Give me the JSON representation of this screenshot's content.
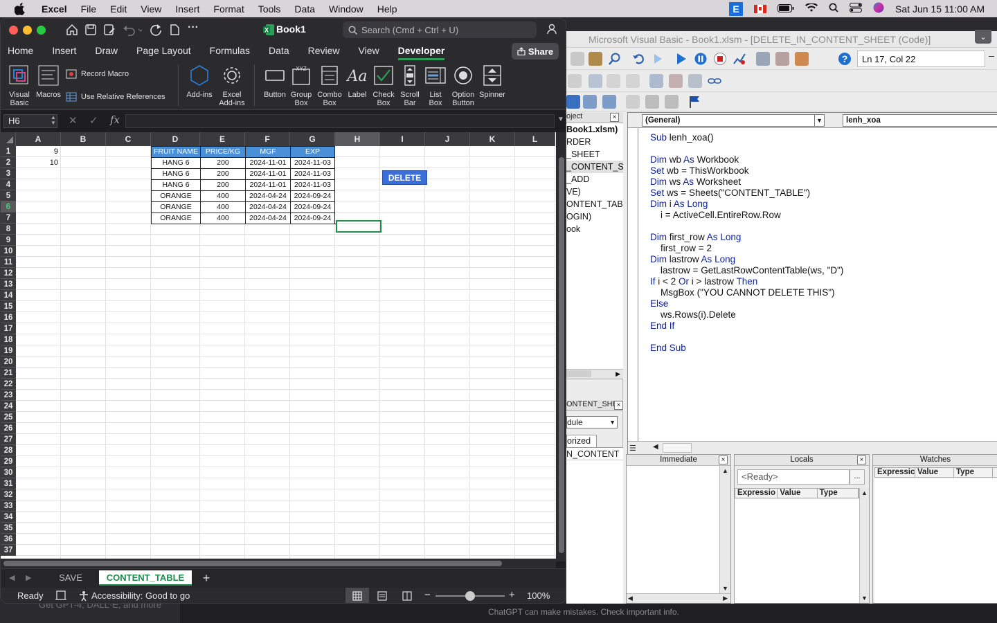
{
  "menubar": {
    "app": "Excel",
    "items": [
      "File",
      "Edit",
      "View",
      "Insert",
      "Format",
      "Tools",
      "Data",
      "Window",
      "Help"
    ],
    "input_badge": "E",
    "datetime": "Sat Jun 15  11:00 AM"
  },
  "background": {
    "left_text": "Get GPT-4, DALL·E, and more",
    "mid_text": "ChatGPT can make mistakes. Check important info."
  },
  "vbe": {
    "title": "Microsoft Visual Basic - Book1.xlsm - [DELETE_IN_CONTENT_SHEET (Code)]",
    "position": "Ln 17, Col 22",
    "project_header": "oject",
    "project_items": [
      "Book1.xlsm)",
      "RDER",
      "_SHEET",
      "_CONTENT_S",
      "_ADD",
      "VE)",
      "ONTENT_TAB",
      "OGIN)",
      "ook"
    ],
    "props_header": "ONTENT_SHE",
    "props_dropdown": "dule",
    "props_tab": "orized",
    "props_value": "N_CONTENT",
    "combo_general": "(General)",
    "combo_proc": "lenh_xoa",
    "code": [
      {
        "t": "Sub lenh_xoa()",
        "k": [
          "Sub"
        ]
      },
      {
        "t": "",
        "k": []
      },
      {
        "t": "Dim wb As Workbook",
        "k": [
          "Dim",
          "As"
        ]
      },
      {
        "t": "Set wb = ThisWorkbook",
        "k": [
          "Set"
        ]
      },
      {
        "t": "Dim ws As Worksheet",
        "k": [
          "Dim",
          "As"
        ]
      },
      {
        "t": "Set ws = Sheets(\"CONTENT_TABLE\")",
        "k": [
          "Set"
        ]
      },
      {
        "t": "Dim i As Long",
        "k": [
          "Dim",
          "As",
          "Long"
        ]
      },
      {
        "t": "    i = ActiveCell.EntireRow.Row",
        "k": []
      },
      {
        "t": "",
        "k": []
      },
      {
        "t": "Dim first_row As Long",
        "k": [
          "Dim",
          "As",
          "Long"
        ]
      },
      {
        "t": "    first_row = 2",
        "k": []
      },
      {
        "t": "Dim lastrow As Long",
        "k": [
          "Dim",
          "As",
          "Long"
        ]
      },
      {
        "t": "    lastrow = GetLastRowContentTable(ws, \"D\")",
        "k": []
      },
      {
        "t": "If i < 2 Or i > lastrow Then",
        "k": [
          "If",
          "Or",
          "Then"
        ]
      },
      {
        "t": "    MsgBox (\"YOU CANNOT DELETE THIS\")",
        "k": []
      },
      {
        "t": "Else",
        "k": [
          "Else"
        ]
      },
      {
        "t": "    ws.Rows(i).Delete",
        "k": []
      },
      {
        "t": "End If",
        "k": [
          "End",
          "If"
        ]
      },
      {
        "t": "",
        "k": []
      },
      {
        "t": "End Sub",
        "k": [
          "End",
          "Sub"
        ]
      }
    ],
    "immediate_title": "Immediate",
    "locals_title": "Locals",
    "locals_status": "<Ready>",
    "locals_ellipsis": "...",
    "locals_cols": [
      "Expressio",
      "Value",
      "Type"
    ],
    "watches_title": "Watches",
    "watches_cols": [
      "Expressic",
      "Value",
      "Type"
    ]
  },
  "excel": {
    "book_title": "Book1",
    "search_placeholder": "Search (Cmd + Ctrl + U)",
    "tabs": [
      "Home",
      "Insert",
      "Draw",
      "Page Layout",
      "Formulas",
      "Data",
      "Review",
      "View",
      "Developer"
    ],
    "active_tab": "Developer",
    "share": "Share",
    "ribbon": {
      "visual_basic": [
        "Visual",
        "Basic"
      ],
      "macros": "Macros",
      "record_macro": "Record Macro",
      "relative_refs": "Use Relative References",
      "addins": "Add-ins",
      "excel_addins": [
        "Excel",
        "Add-ins"
      ],
      "button": "Button",
      "group_box": [
        "Group",
        "Box"
      ],
      "combo_box": [
        "Combo",
        "Box"
      ],
      "label": "Label",
      "check_box": [
        "Check",
        "Box"
      ],
      "scroll_bar": [
        "Scroll",
        "Bar"
      ],
      "list_box": [
        "List",
        "Box"
      ],
      "option_button": [
        "Option",
        "Button"
      ],
      "spinner": "Spinner"
    },
    "name_box": "H6",
    "fx": "fx",
    "columns": [
      "A",
      "B",
      "C",
      "D",
      "E",
      "F",
      "G",
      "H",
      "I",
      "J",
      "K",
      "L"
    ],
    "selected_col": "H",
    "selected_row": 6,
    "a_values": [
      {
        "row": 1,
        "v": "9"
      },
      {
        "row": 2,
        "v": "10"
      }
    ],
    "table_header": [
      "FRUIT NAME",
      "PRICE/KG",
      "MGF",
      "EXP"
    ],
    "table_rows": [
      [
        "HANG 6",
        "200",
        "2024-11-01",
        "2024-11-03"
      ],
      [
        "HANG 6",
        "200",
        "2024-11-01",
        "2024-11-03"
      ],
      [
        "HANG 6",
        "200",
        "2024-11-01",
        "2024-11-03"
      ],
      [
        "ORANGE",
        "400",
        "2024-04-24",
        "2024-09-24"
      ],
      [
        "ORANGE",
        "400",
        "2024-04-24",
        "2024-09-24"
      ],
      [
        "ORANGE",
        "400",
        "2024-04-24",
        "2024-09-24"
      ]
    ],
    "delete_button": "DELETE",
    "sheet_tabs": [
      "SAVE",
      "CONTENT_TABLE"
    ],
    "active_sheet": "CONTENT_TABLE",
    "add_sheet": "+",
    "status_ready": "Ready",
    "accessibility": "Accessibility: Good to go",
    "zoom": "100%",
    "zoom_minus": "−",
    "zoom_plus": "+",
    "colors": {
      "accent": "#2aa05a",
      "table_header": "#4a90d9",
      "delete": "#3b6fd8"
    }
  }
}
